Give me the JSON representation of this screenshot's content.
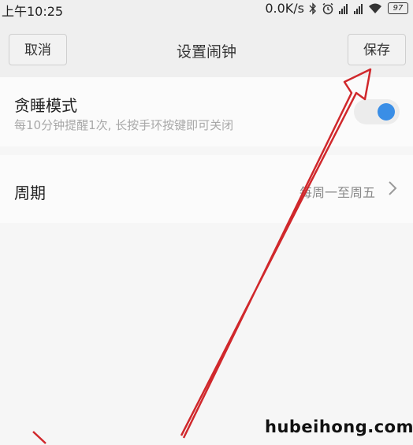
{
  "status_bar": {
    "time": "上午10:25",
    "network_speed": "0.0K/s",
    "battery_level": "97",
    "icons": [
      "bluetooth-icon",
      "alarm-icon",
      "signal-icon",
      "signal-icon",
      "wifi-icon",
      "battery-icon"
    ]
  },
  "header": {
    "title": "设置闹钟",
    "cancel_label": "取消",
    "save_label": "保存"
  },
  "snooze": {
    "label": "贪睡模式",
    "description": "每10分钟提醒1次, 长按手环按键即可关闭",
    "enabled": true
  },
  "period": {
    "label": "周期",
    "value": "每周一至周五"
  },
  "colors": {
    "accent": "#3a8ee6",
    "annotation_arrow": "#d0282c"
  },
  "watermark": "hubeihong.com"
}
